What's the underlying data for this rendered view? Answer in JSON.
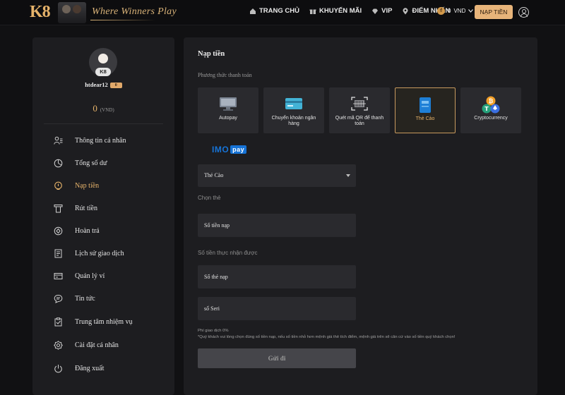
{
  "header": {
    "logo": "K8",
    "tagline": "Where Winners Play",
    "nav": [
      {
        "label": "TRANG CHỦ",
        "icon": "home-icon"
      },
      {
        "label": "KHUYẾN MÃI",
        "icon": "gift-icon"
      },
      {
        "label": "VIP",
        "icon": "diamond-icon"
      },
      {
        "label": "ĐIỂM NHẤN",
        "icon": "location-icon"
      }
    ],
    "balance": {
      "amount": "0",
      "currency": "VND"
    },
    "deposit_button": "NẠP TIỀN"
  },
  "sidebar": {
    "avatar_badge": "K8",
    "username": "htdear12",
    "vip_badge": "0",
    "balance": {
      "amount": "0",
      "currency": "(VND)"
    },
    "items": [
      {
        "label": "Thông tin cá nhân",
        "icon": "profile-icon",
        "active": false
      },
      {
        "label": "Tổng số dư",
        "icon": "balance-icon",
        "active": false
      },
      {
        "label": "Nạp tiền",
        "icon": "deposit-icon",
        "active": true
      },
      {
        "label": "Rút tiền",
        "icon": "withdraw-icon",
        "active": false
      },
      {
        "label": "Hoàn trả",
        "icon": "rebate-icon",
        "active": false
      },
      {
        "label": "Lịch sử giao dịch",
        "icon": "history-icon",
        "active": false
      },
      {
        "label": "Quản lý ví",
        "icon": "wallet-icon",
        "active": false
      },
      {
        "label": "Tin tức",
        "icon": "news-icon",
        "active": false
      },
      {
        "label": "Trung tâm nhiệm vụ",
        "icon": "mission-icon",
        "active": false
      },
      {
        "label": "Cài đặt cá nhân",
        "icon": "settings-icon",
        "active": false
      },
      {
        "label": "Đăng xuất",
        "icon": "logout-icon",
        "active": false
      }
    ]
  },
  "main": {
    "title": "Nạp tiền",
    "method_label": "Phương thức thanh toán",
    "methods": [
      {
        "label": "Autopay",
        "icon": "monitor-icon",
        "active": false
      },
      {
        "label": "Chuyển khoản ngân hàng",
        "icon": "bank-card-icon",
        "active": false
      },
      {
        "label": "Quét mã QR để thanh toán",
        "icon": "qr-code-icon",
        "active": false
      },
      {
        "label": "Thẻ Cào",
        "icon": "scratch-card-icon",
        "active": true
      },
      {
        "label": "Cryptocurrency",
        "icon": "crypto-icon",
        "active": false
      }
    ],
    "provider": {
      "name": "IMO",
      "suffix": "pay"
    },
    "card_select": "Thẻ Cào",
    "choose_card_label": "Chọn thẻ",
    "amount_placeholder": "Số tiền nạp",
    "received_label": "Số tiền thực nhận được",
    "card_number_placeholder": "Số thẻ nạp",
    "serial_placeholder": "số Seri",
    "fee_note": "Phí giao dịch 0%",
    "warning_note": "*Quý khách vui lòng chọn đúng số tiền nạp, nếu số tiền nhỏ hơn mệnh giá thẻ tích điểm, mệnh giá trên sẽ căn cứ vào số tiền quý khách chọn!",
    "submit_label": "Gửi đi"
  },
  "colors": {
    "accent": "#e6b36a",
    "button": "#e7b47a",
    "panel": "#1d1d20",
    "background": "#111113"
  }
}
